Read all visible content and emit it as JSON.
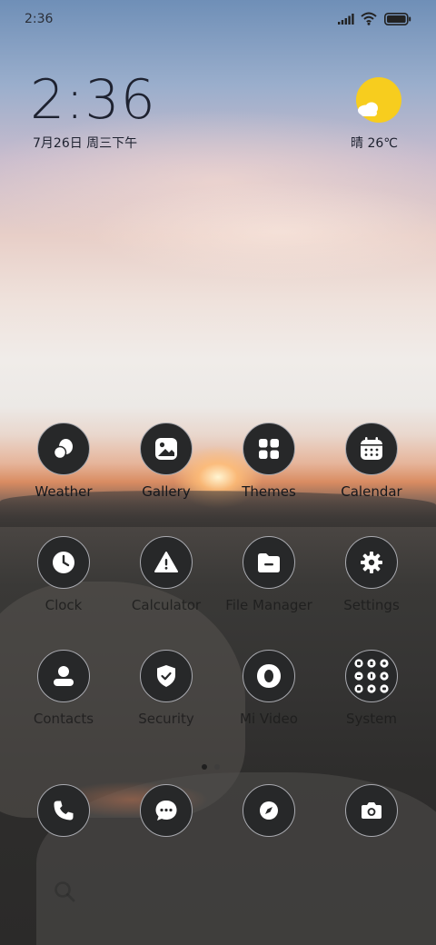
{
  "status_bar": {
    "time": "2:36"
  },
  "clock_widget": {
    "time": "2:36",
    "date": "7月26日 周三下午"
  },
  "weather_widget": {
    "text": "晴 26℃",
    "icon": "sun-cloud-icon"
  },
  "apps": [
    {
      "label": "Weather",
      "icon": "weather-icon"
    },
    {
      "label": "Gallery",
      "icon": "gallery-icon"
    },
    {
      "label": "Themes",
      "icon": "themes-icon"
    },
    {
      "label": "Calendar",
      "icon": "calendar-icon"
    },
    {
      "label": "Clock",
      "icon": "clock-icon"
    },
    {
      "label": "Calculator",
      "icon": "calculator-icon"
    },
    {
      "label": "File Manager",
      "icon": "file-manager-icon"
    },
    {
      "label": "Settings",
      "icon": "settings-icon"
    },
    {
      "label": "Contacts",
      "icon": "contacts-icon"
    },
    {
      "label": "Security",
      "icon": "security-icon"
    },
    {
      "label": "Mi Video",
      "icon": "mi-video-icon"
    },
    {
      "label": "System",
      "icon": "system-folder-icon"
    }
  ],
  "dock": [
    {
      "icon": "phone-icon"
    },
    {
      "icon": "messages-icon"
    },
    {
      "icon": "browser-icon"
    },
    {
      "icon": "camera-icon"
    }
  ],
  "page_indicator": {
    "pages": 2,
    "current": 1
  },
  "colors": {
    "icon_bg": "#272829",
    "icon_border": "#a9aab0",
    "weather_sun": "#f7cd1e"
  }
}
